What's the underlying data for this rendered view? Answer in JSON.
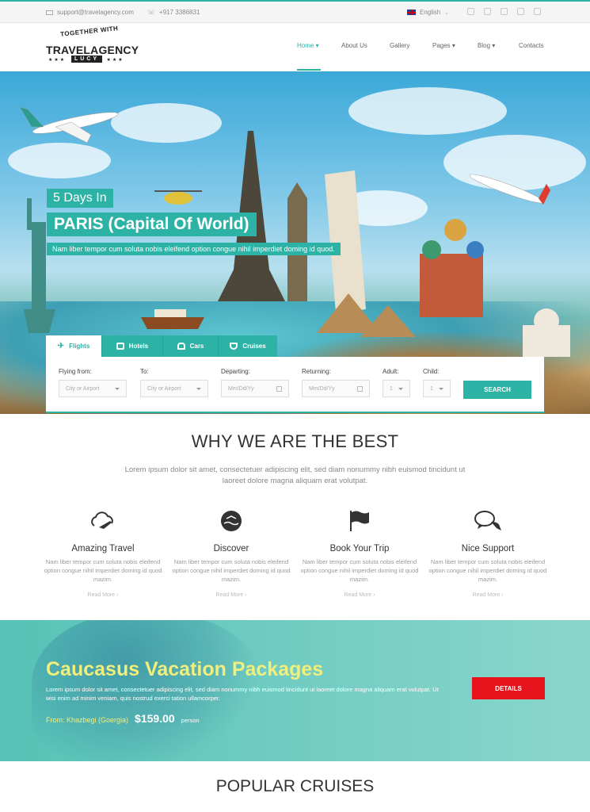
{
  "topbar": {
    "email": "support@travelagency.com",
    "phone": "+917 3386831",
    "language": "English",
    "socials": [
      "facebook-icon",
      "twitter-icon",
      "google-plus-icon",
      "instagram-icon",
      "vine-icon"
    ]
  },
  "logo": {
    "top_text": "TOGETHER WITH",
    "main_text": "TRAVELAGENCY",
    "badge_text": "LUCY"
  },
  "nav": {
    "items": [
      "Home",
      "About Us",
      "Gallery",
      "Pages",
      "Blog",
      "Contacts"
    ],
    "active": "Home"
  },
  "hero": {
    "caption_small": "5 Days In",
    "caption_big": "PARIS (Capital Of World)",
    "caption_text": "Nam liber tempor cum soluta nobis eleifend option congue nihil imperdiet doming id quod."
  },
  "search": {
    "tabs": [
      "Flights",
      "Hotels",
      "Cars",
      "Cruises"
    ],
    "active_tab": "Flights",
    "fields": {
      "from_label": "Flying from:",
      "from_placeholder": "City or Airport",
      "to_label": "To:",
      "to_placeholder": "City or Airport",
      "depart_label": "Departing:",
      "depart_placeholder": "Mm/Dd/Yy",
      "return_label": "Returning:",
      "return_placeholder": "Mm/Dd/Yy",
      "adult_label": "Adult:",
      "adult_value": "1",
      "child_label": "Child:",
      "child_value": "1"
    },
    "button": "SEARCH"
  },
  "why": {
    "title": "WHY WE ARE THE BEST",
    "subtitle": "Lorem ipsum dolor sit amet, consectetuer adipiscing elit, sed diam nonummy nibh euismod tincidunt ut laoreet dolore magna aliquam erat volutpat.",
    "features": [
      {
        "icon": "plane-cloud-icon",
        "title": "Amazing Travel",
        "desc": "Nam liber tempor cum soluta nobis eleifend option congue nihil imperdiet doming id quod mazim.",
        "more": "Read More"
      },
      {
        "icon": "island-icon",
        "title": "Discover",
        "desc": "Nam liber tempor cum soluta nobis eleifend option congue nihil imperdiet doming id quod mazim.",
        "more": "Read More"
      },
      {
        "icon": "flag-icon",
        "title": "Book Your Trip",
        "desc": "Nam liber tempor cum soluta nobis eleifend option congue nihil imperdiet doming id quod mazim.",
        "more": "Read More"
      },
      {
        "icon": "chat-bubbles-icon",
        "title": "Nice Support",
        "desc": "Nam liber tempor cum soluta nobis eleifend option congue nihil imperdiet doming id quod mazim.",
        "more": "Read More"
      }
    ]
  },
  "promo": {
    "title": "Caucasus Vacation Packages",
    "desc": "Lorem ipsum dolor sit amet, consectetuer adipiscing elit, sed diam nonummy nibh euismod tincidunt ut laoreet dolore magna aliquam erat volutpat. Ut wisi enim ad minim veniam, quis nostrud exerci tation ullamcorper.",
    "from": "From: Khazbegi (Goergia)",
    "price": "$159.00",
    "unit": "person",
    "button": "DETAILS"
  },
  "cruises": {
    "title": "POPULAR CRUISES"
  },
  "colors": {
    "accent": "#2cb3a5",
    "promo_title": "#f1ee7c",
    "details_button": "#e8141d"
  }
}
